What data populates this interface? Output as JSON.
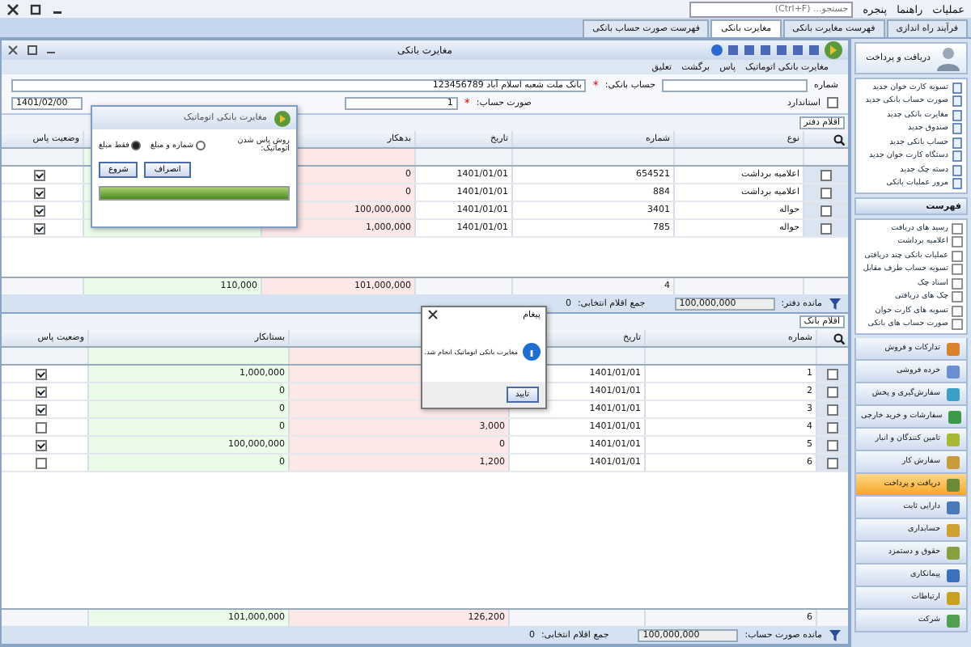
{
  "menu": {
    "items": [
      "عملیات",
      "راهنما",
      "پنجره"
    ],
    "search": {
      "placeholder": "جستجو... (Ctrl+F)"
    }
  },
  "tabs": [
    {
      "label": "فرآیند راه اندازی",
      "selected": false
    },
    {
      "label": "فهرست مغایرت بانکی",
      "selected": false
    },
    {
      "label": "مغایرت بانکی",
      "selected": true
    },
    {
      "label": "فهرست صورت حساب بانکی",
      "selected": false
    }
  ],
  "window": {
    "title": "مغایرت بانکی"
  },
  "actions": [
    "مغایرت بانکی اتوماتیک",
    "پاس",
    "برگشت",
    "تعلیق"
  ],
  "form": {
    "number_label": "شماره",
    "bank_account_label": "حساب بانکی:",
    "required_mark": "*",
    "bank_account_value": "بانک ملت شعبه اسلام آباد 123456789",
    "statement_label": "صورت حساب:",
    "statement_value": "1",
    "check_label": "استاندارد",
    "check_checked": false,
    "date_value": "1401/02/00"
  },
  "ledger": {
    "title": "اقلام دفتر",
    "columns": [
      "نوع",
      "شماره",
      "تاریخ",
      "بدهکار",
      "وضعیت پاس"
    ],
    "rows": [
      {
        "type": "اعلامیه برداشت",
        "number": "654521",
        "date": "1401/01/01",
        "debit": "0",
        "selected": false,
        "passed": true
      },
      {
        "type": "اعلامیه برداشت",
        "number": "884",
        "date": "1401/01/01",
        "debit": "0",
        "selected": false,
        "passed": true
      },
      {
        "type": "حواله",
        "number": "3401",
        "date": "1401/01/01",
        "debit": "100,000,000",
        "selected": false,
        "passed": true
      },
      {
        "type": "حواله",
        "number": "785",
        "date": "1401/01/01",
        "debit": "1,000,000",
        "selected": false,
        "passed": true
      }
    ],
    "footer": {
      "count": "4",
      "debit": "101,000,000",
      "credit": "110,000"
    },
    "status": {
      "balance_label": "مانده دفتر:",
      "balance": "100,000,000",
      "selected_label": "جمع اقلام انتخابی:",
      "selected_value": "0"
    }
  },
  "bank": {
    "title": "اقلام بانک",
    "columns": [
      "شماره",
      "تاریخ",
      "بستانکار",
      "وضعیت پاس"
    ],
    "rows": [
      {
        "number": "1",
        "date": "1401/01/01",
        "credit": "1,000,000",
        "selected": false,
        "passed": true
      },
      {
        "number": "2",
        "date": "1401/01/01",
        "credit": "0",
        "selected": false,
        "passed": true
      },
      {
        "number": "3",
        "date": "1401/01/01",
        "credit": "0",
        "selected": false,
        "passed": true
      },
      {
        "number": "4",
        "date": "1401/01/01",
        "debit": "3,000",
        "credit": "0",
        "selected": false,
        "passed": false
      },
      {
        "number": "5",
        "date": "1401/01/01",
        "debit": "0",
        "credit": "100,000,000",
        "selected": false,
        "passed": true
      },
      {
        "number": "6",
        "date": "1401/01/01",
        "debit": "1,200",
        "credit": "0",
        "selected": false,
        "passed": false
      }
    ],
    "footer": {
      "count": "6",
      "debit": "126,200",
      "credit": "101,000,000"
    },
    "status": {
      "balance_label": "مانده صورت حساب:",
      "balance": "100,000,000",
      "selected_label": "جمع اقلام انتخابی:",
      "selected_value": "0"
    }
  },
  "auto_dialog": {
    "title": "مغایرت بانکی اتوماتیک",
    "method_label": "روش پاس شدن اتوماتیک:",
    "options": [
      {
        "label": "شماره و مبلغ",
        "selected": false
      },
      {
        "label": "فقط مبلغ",
        "selected": true
      }
    ],
    "buttons": [
      "انصراف",
      "شروع"
    ],
    "progress": {
      "level": 1
    }
  },
  "message": {
    "title": "پیغام",
    "text": "مغایرت بانکی اتوماتیک انجام شد.",
    "button": "تایید"
  },
  "sidebar": {
    "title": "دریافت و پرداخت",
    "new_items": [
      "تسویه کارت خوان جدید",
      "صورت حساب بانکی جدید",
      "مغایرت بانکی جدید",
      "صندوق جدید",
      "حساب بانکی جدید",
      "دستگاه کارت خوان جدید",
      "دسته چک جدید",
      "مرور عملیات بانکی"
    ],
    "list_title": "فهرست",
    "list_items": [
      "رسید های دریافت",
      "اعلامیه برداشت",
      "عملیات بانکی چند دریافتی",
      "تسویه حساب طرف مقابل",
      "اسناد چک",
      "چک های دریافتی",
      "تسویه های کارت خوان",
      "صورت حساب های بانکی"
    ],
    "modules": [
      {
        "label": "تدارکات و فروش",
        "selected": false
      },
      {
        "label": "خرده فروشی",
        "selected": false
      },
      {
        "label": "سفارش‌گیری و پخش",
        "selected": false
      },
      {
        "label": "سفارشات و خرید خارجی",
        "selected": false
      },
      {
        "label": "تامین کنندگان و انبار",
        "selected": false
      },
      {
        "label": "سفارش کار",
        "selected": false
      },
      {
        "label": "دریافت و پرداخت",
        "selected": true
      },
      {
        "label": "دارایی ثابت",
        "selected": false
      },
      {
        "label": "حسابداری",
        "selected": false
      },
      {
        "label": "حقوق و دستمزد",
        "selected": false
      },
      {
        "label": "پیمانکاری",
        "selected": false
      },
      {
        "label": "ارتباطات",
        "selected": false
      },
      {
        "label": "شرکت",
        "selected": false
      }
    ]
  }
}
